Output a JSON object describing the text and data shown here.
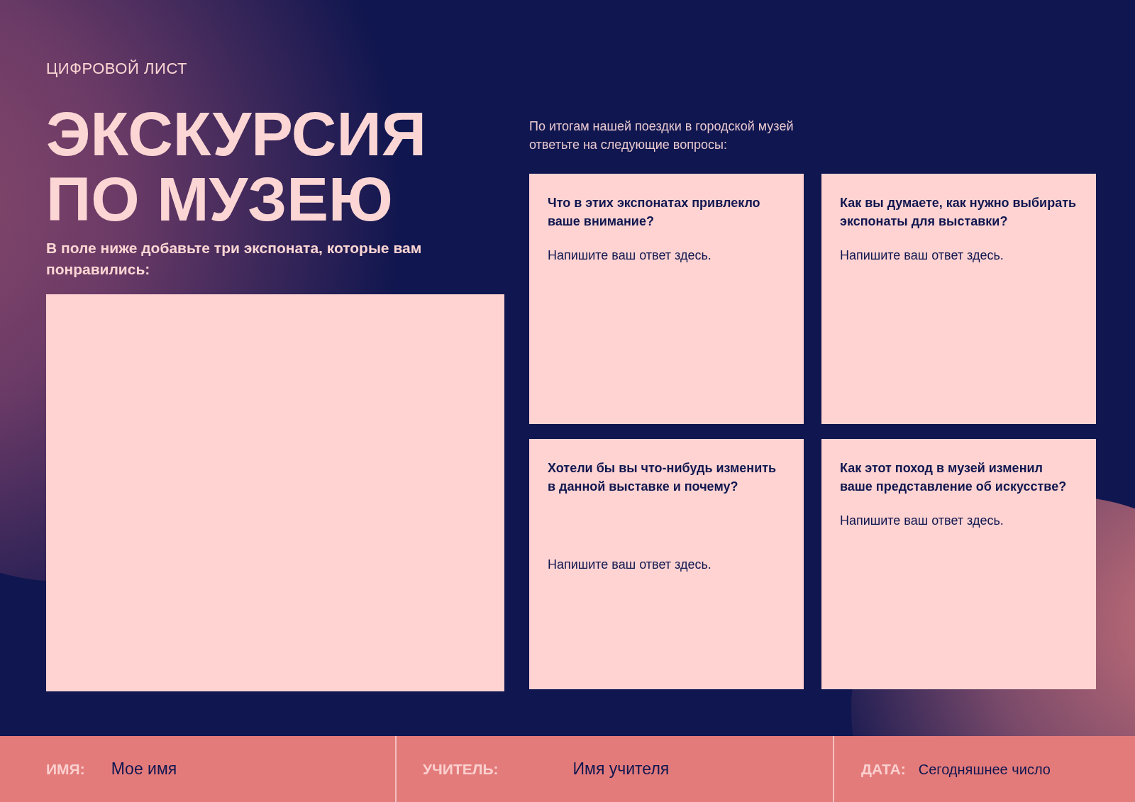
{
  "eyebrow": "ЦИФРОВОЙ ЛИСТ",
  "title_lines": [
    "ЭКСКУРСИЯ",
    "ПО МУЗЕЮ"
  ],
  "instruction": "В поле ниже добавьте три экспоната, которые вам понравились:",
  "intro": "По итогам нашей поездки в городской музей ответьте на следующие вопросы:",
  "cards": [
    {
      "question": "Что в этих экспонатах привлекло ваше внимание?",
      "placeholder": "Напишите ваш ответ здесь."
    },
    {
      "question": "Как вы думаете, как нужно выбирать экспонаты для выставки?",
      "placeholder": "Напишите ваш ответ здесь."
    },
    {
      "question": "Хотели бы вы что-нибудь изменить в данной выставке и почему?",
      "placeholder": "Напишите ваш ответ здесь."
    },
    {
      "question": "Как этот поход в музей изменил ваше представление об искусстве?",
      "placeholder": "Напишите ваш ответ здесь."
    }
  ],
  "footer": [
    {
      "label": "ИМЯ:",
      "value": "Мое имя"
    },
    {
      "label": "УЧИТЕЛЬ:",
      "value": "Имя учителя"
    },
    {
      "label": "ДАТА:",
      "value": "Сегодняшнее число"
    }
  ]
}
